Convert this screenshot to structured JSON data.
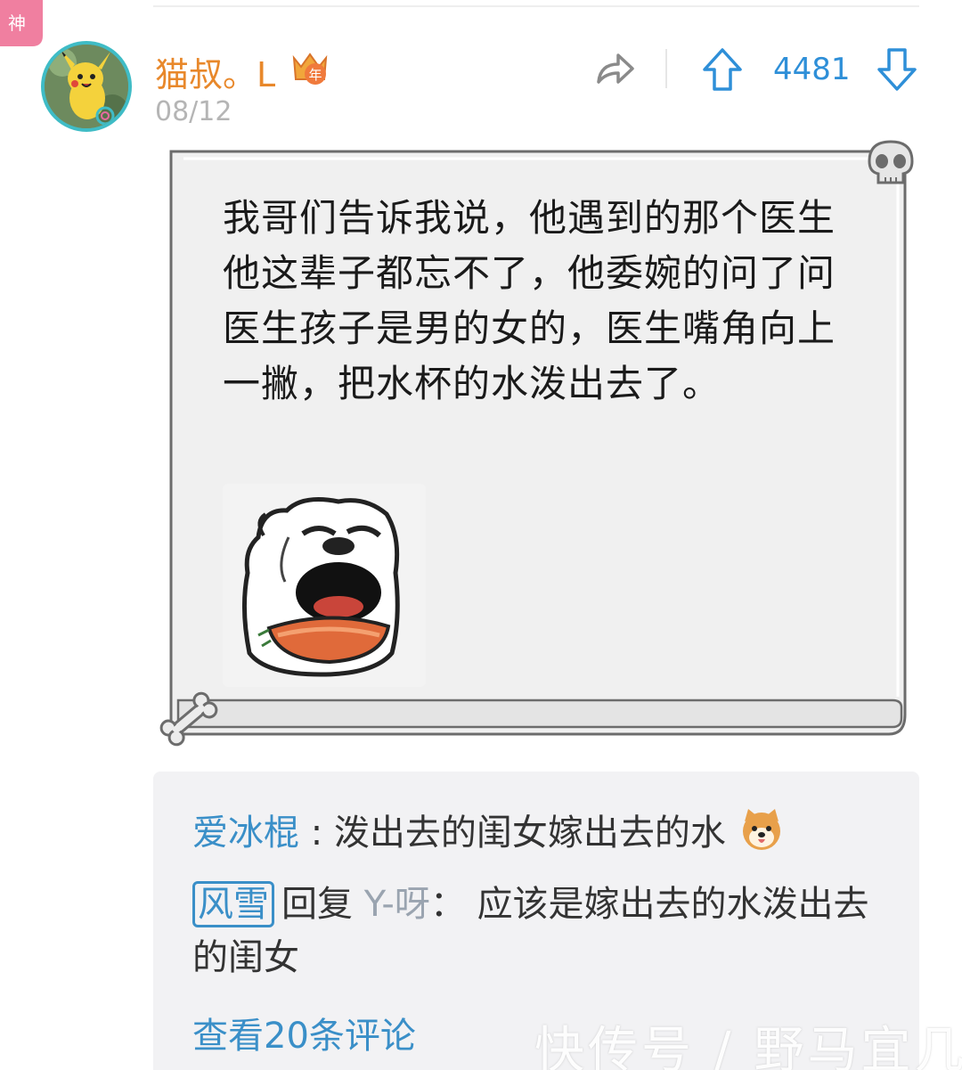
{
  "badge": {
    "label": "神",
    "color": "#f07fa0"
  },
  "post": {
    "author": "猫叔。L",
    "author_icon": "crown-year-icon",
    "date": "08/12",
    "vote_count": "4481",
    "text": "我哥们告诉我说，他遇到的那个医生他这辈子都忘不了，他委婉的问了问医生孩子是男的女的，医生嘴角向上一撇，把水杯的水泼出去了。",
    "image_icon": "crying-bear-meme"
  },
  "actions": {
    "share_icon": "share-icon",
    "upvote_icon": "arrow-up-icon",
    "downvote_icon": "arrow-down-icon"
  },
  "comments": {
    "items": [
      {
        "name": "爱冰棍",
        "separator": ":",
        "text": "泼出去的闺女嫁出去的水",
        "emoji": "shiba-dog-emoji"
      },
      {
        "name": "风雪",
        "reply_word": "回复",
        "target": "Y-呀",
        "separator": "：",
        "text": "应该是嫁出去的水泼出去的闺女"
      }
    ],
    "more_label": "查看20条评论"
  },
  "watermark": "快传号 / 野马宜几",
  "colors": {
    "accent": "#2e8fd8",
    "author": "#e8882b",
    "link": "#3a8fc8"
  }
}
